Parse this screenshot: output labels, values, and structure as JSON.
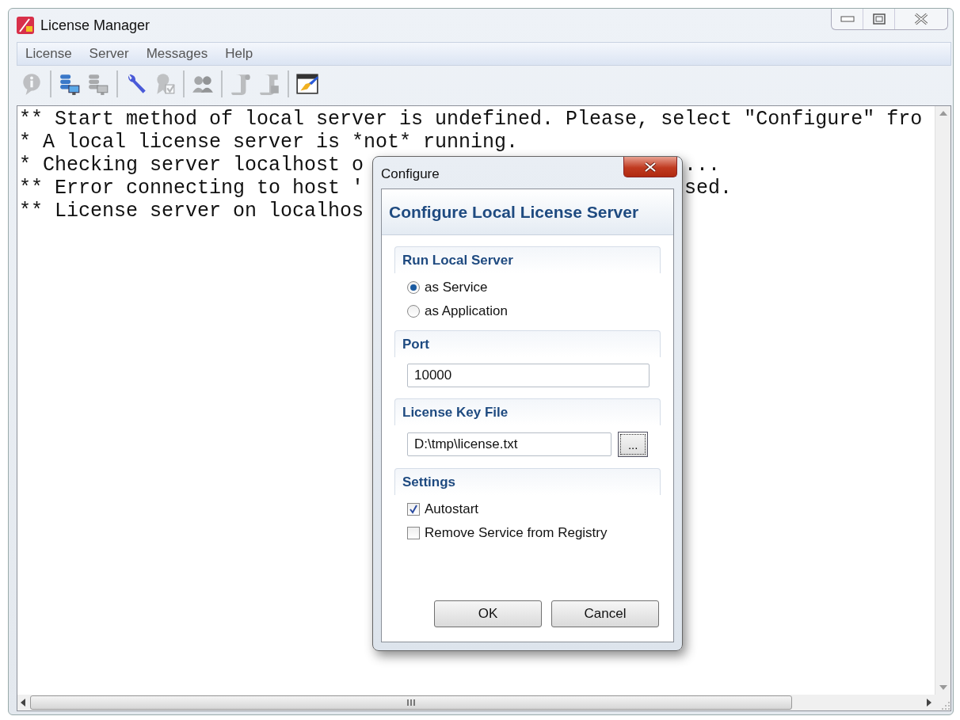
{
  "window": {
    "title": "License Manager"
  },
  "menu": [
    "License",
    "Server",
    "Messages",
    "Help"
  ],
  "toolbar": {
    "groups": [
      [
        {
          "disabled": true
        }
      ],
      [
        {
          "disabled": false
        },
        {
          "disabled": true
        }
      ],
      [
        {
          "disabled": false
        },
        {
          "disabled": true
        }
      ],
      [
        {
          "disabled": true
        }
      ],
      [
        {
          "disabled": true
        },
        {
          "disabled": true
        }
      ],
      [
        {
          "disabled": false
        }
      ]
    ]
  },
  "log": {
    "lines": [
      {
        "text": "** Start method of local server is undefined. Please, select \"Configure\" fro"
      },
      {
        "text": "* A local license server is *not* running."
      },
      {
        "text": "* Checking server localhost o",
        "tail": "..."
      },
      {
        "text": "** Error connecting to host '",
        "tail": "sed."
      },
      {
        "text": "** License server on localhos"
      }
    ]
  },
  "dialog": {
    "title": "Configure",
    "heading": "Configure Local License Server",
    "sections": [
      {
        "kind": "radio",
        "title": "Run Local Server",
        "options": [
          {
            "label": "as Service",
            "selected": true
          },
          {
            "label": "as Application",
            "selected": false
          }
        ]
      },
      {
        "kind": "text",
        "title": "Port",
        "value": "10000"
      },
      {
        "kind": "file",
        "title": "License Key File",
        "value": "D:\\tmp\\license.txt",
        "browse": "..."
      },
      {
        "kind": "checkbox",
        "title": "Settings",
        "options": [
          {
            "label": "Autostart",
            "checked": true
          },
          {
            "label": "Remove Service from Registry",
            "checked": false
          }
        ]
      }
    ],
    "buttons": [
      "OK",
      "Cancel"
    ]
  }
}
